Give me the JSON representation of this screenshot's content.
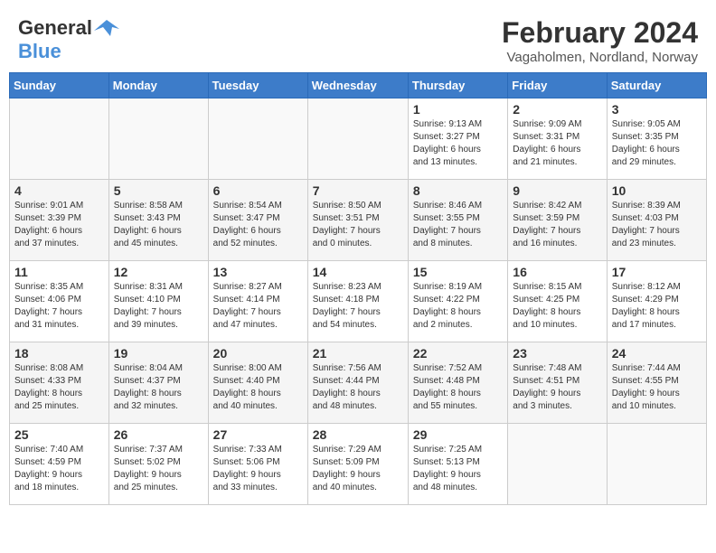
{
  "header": {
    "logo_general": "General",
    "logo_blue": "Blue",
    "main_title": "February 2024",
    "subtitle": "Vagaholmen, Nordland, Norway"
  },
  "calendar": {
    "days_of_week": [
      "Sunday",
      "Monday",
      "Tuesday",
      "Wednesday",
      "Thursday",
      "Friday",
      "Saturday"
    ],
    "weeks": [
      {
        "days": [
          {
            "num": "",
            "info": ""
          },
          {
            "num": "",
            "info": ""
          },
          {
            "num": "",
            "info": ""
          },
          {
            "num": "",
            "info": ""
          },
          {
            "num": "1",
            "info": "Sunrise: 9:13 AM\nSunset: 3:27 PM\nDaylight: 6 hours\nand 13 minutes."
          },
          {
            "num": "2",
            "info": "Sunrise: 9:09 AM\nSunset: 3:31 PM\nDaylight: 6 hours\nand 21 minutes."
          },
          {
            "num": "3",
            "info": "Sunrise: 9:05 AM\nSunset: 3:35 PM\nDaylight: 6 hours\nand 29 minutes."
          }
        ]
      },
      {
        "days": [
          {
            "num": "4",
            "info": "Sunrise: 9:01 AM\nSunset: 3:39 PM\nDaylight: 6 hours\nand 37 minutes."
          },
          {
            "num": "5",
            "info": "Sunrise: 8:58 AM\nSunset: 3:43 PM\nDaylight: 6 hours\nand 45 minutes."
          },
          {
            "num": "6",
            "info": "Sunrise: 8:54 AM\nSunset: 3:47 PM\nDaylight: 6 hours\nand 52 minutes."
          },
          {
            "num": "7",
            "info": "Sunrise: 8:50 AM\nSunset: 3:51 PM\nDaylight: 7 hours\nand 0 minutes."
          },
          {
            "num": "8",
            "info": "Sunrise: 8:46 AM\nSunset: 3:55 PM\nDaylight: 7 hours\nand 8 minutes."
          },
          {
            "num": "9",
            "info": "Sunrise: 8:42 AM\nSunset: 3:59 PM\nDaylight: 7 hours\nand 16 minutes."
          },
          {
            "num": "10",
            "info": "Sunrise: 8:39 AM\nSunset: 4:03 PM\nDaylight: 7 hours\nand 23 minutes."
          }
        ]
      },
      {
        "days": [
          {
            "num": "11",
            "info": "Sunrise: 8:35 AM\nSunset: 4:06 PM\nDaylight: 7 hours\nand 31 minutes."
          },
          {
            "num": "12",
            "info": "Sunrise: 8:31 AM\nSunset: 4:10 PM\nDaylight: 7 hours\nand 39 minutes."
          },
          {
            "num": "13",
            "info": "Sunrise: 8:27 AM\nSunset: 4:14 PM\nDaylight: 7 hours\nand 47 minutes."
          },
          {
            "num": "14",
            "info": "Sunrise: 8:23 AM\nSunset: 4:18 PM\nDaylight: 7 hours\nand 54 minutes."
          },
          {
            "num": "15",
            "info": "Sunrise: 8:19 AM\nSunset: 4:22 PM\nDaylight: 8 hours\nand 2 minutes."
          },
          {
            "num": "16",
            "info": "Sunrise: 8:15 AM\nSunset: 4:25 PM\nDaylight: 8 hours\nand 10 minutes."
          },
          {
            "num": "17",
            "info": "Sunrise: 8:12 AM\nSunset: 4:29 PM\nDaylight: 8 hours\nand 17 minutes."
          }
        ]
      },
      {
        "days": [
          {
            "num": "18",
            "info": "Sunrise: 8:08 AM\nSunset: 4:33 PM\nDaylight: 8 hours\nand 25 minutes."
          },
          {
            "num": "19",
            "info": "Sunrise: 8:04 AM\nSunset: 4:37 PM\nDaylight: 8 hours\nand 32 minutes."
          },
          {
            "num": "20",
            "info": "Sunrise: 8:00 AM\nSunset: 4:40 PM\nDaylight: 8 hours\nand 40 minutes."
          },
          {
            "num": "21",
            "info": "Sunrise: 7:56 AM\nSunset: 4:44 PM\nDaylight: 8 hours\nand 48 minutes."
          },
          {
            "num": "22",
            "info": "Sunrise: 7:52 AM\nSunset: 4:48 PM\nDaylight: 8 hours\nand 55 minutes."
          },
          {
            "num": "23",
            "info": "Sunrise: 7:48 AM\nSunset: 4:51 PM\nDaylight: 9 hours\nand 3 minutes."
          },
          {
            "num": "24",
            "info": "Sunrise: 7:44 AM\nSunset: 4:55 PM\nDaylight: 9 hours\nand 10 minutes."
          }
        ]
      },
      {
        "days": [
          {
            "num": "25",
            "info": "Sunrise: 7:40 AM\nSunset: 4:59 PM\nDaylight: 9 hours\nand 18 minutes."
          },
          {
            "num": "26",
            "info": "Sunrise: 7:37 AM\nSunset: 5:02 PM\nDaylight: 9 hours\nand 25 minutes."
          },
          {
            "num": "27",
            "info": "Sunrise: 7:33 AM\nSunset: 5:06 PM\nDaylight: 9 hours\nand 33 minutes."
          },
          {
            "num": "28",
            "info": "Sunrise: 7:29 AM\nSunset: 5:09 PM\nDaylight: 9 hours\nand 40 minutes."
          },
          {
            "num": "29",
            "info": "Sunrise: 7:25 AM\nSunset: 5:13 PM\nDaylight: 9 hours\nand 48 minutes."
          },
          {
            "num": "",
            "info": ""
          },
          {
            "num": "",
            "info": ""
          }
        ]
      }
    ]
  }
}
